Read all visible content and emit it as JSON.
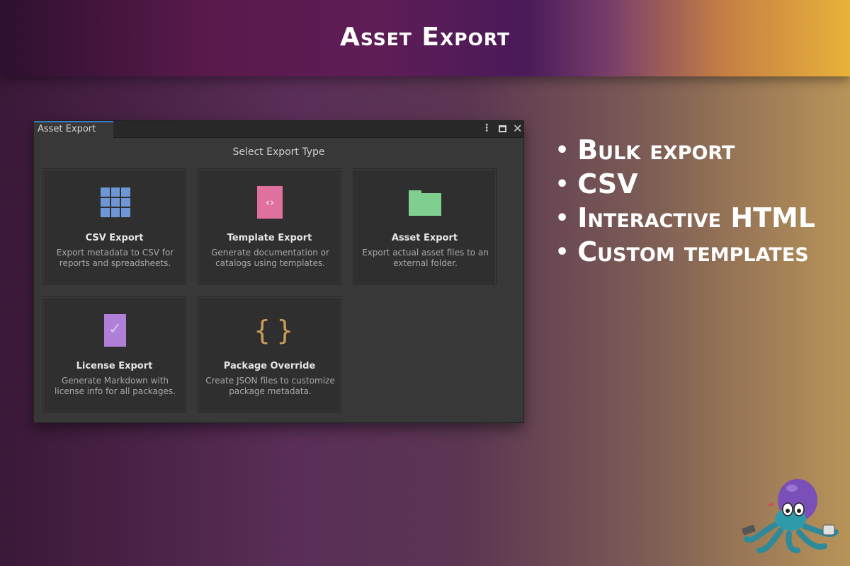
{
  "banner": {
    "title": "Asset Export"
  },
  "window": {
    "tab_label": "Asset Export",
    "header": "Select Export Type",
    "cards": [
      {
        "title": "CSV Export",
        "description": "Export metadata to CSV for reports and spreadsheets.",
        "icon": "grid-icon",
        "color": "#6f97d6"
      },
      {
        "title": "Template Export",
        "description": "Generate documentation or catalogs using templates.",
        "icon": "template-icon",
        "color": "#e0709e"
      },
      {
        "title": "Asset Export",
        "description": "Export actual asset files to an external folder.",
        "icon": "folder-icon",
        "color": "#7fcf91"
      },
      {
        "title": "License Export",
        "description": "Generate Markdown with license info for all packages.",
        "icon": "license-icon",
        "color": "#b07fd8"
      },
      {
        "title": "Package Override",
        "description": "Create JSON files to customize package metadata.",
        "icon": "braces-icon",
        "color": "#c99d5a"
      }
    ]
  },
  "features": [
    "Bulk export",
    "CSV",
    "Interactive HTML",
    "Custom templates"
  ],
  "colors": {
    "tab_accent": "#3a79bb",
    "window_bg": "#383838",
    "card_bg": "#2f2f2f"
  }
}
